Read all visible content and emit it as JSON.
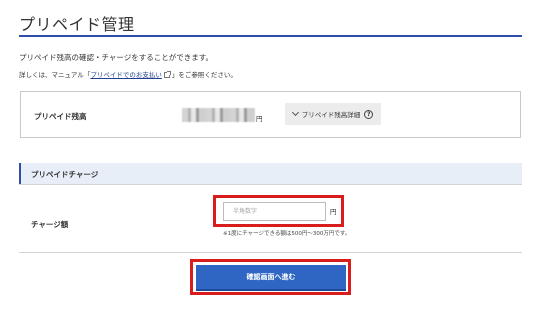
{
  "page": {
    "title": "プリペイド管理",
    "intro": "プリペイド残高の確認・チャージをすることができます。",
    "detail_prefix": "詳しくは、マニュアル「",
    "detail_link": "プリペイドでのお支払い",
    "detail_suffix": "」をご参照ください。"
  },
  "balance": {
    "label": "プリペイド残高",
    "unit": "円",
    "detail_button_label": "プリペイド残高詳細",
    "help_icon_glyph": "?"
  },
  "charge": {
    "section_title": "プリペイドチャージ",
    "amount_label": "チャージ額",
    "input_value": "",
    "input_placeholder": "半角数字",
    "unit": "円",
    "note": "※1度にチャージできる額は500円〜300万円です。",
    "submit_label": "確認画面へ進む"
  },
  "colors": {
    "accent": "#2d4fa8",
    "primary_button": "#2f66c4",
    "highlight": "#d91c1c",
    "section_bg": "#e8eef8"
  }
}
